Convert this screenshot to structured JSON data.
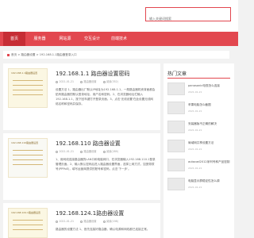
{
  "search": {
    "placeholder": "输入关键词搜索"
  },
  "nav": [
    {
      "label": "首页"
    },
    {
      "label": "服务器"
    },
    {
      "label": "网站源"
    },
    {
      "label": "交互设计"
    },
    {
      "label": "前端技术"
    }
  ],
  "breadcrumb": "首页 > 路由器设置 > 192.168.1.1路由器登录入口",
  "articles": [
    {
      "thumb_title": "192.168.1.1路由器设置",
      "title": "192.168.1.1 路由器设置密码",
      "date": "2021-01-21",
      "category": "路由器设置",
      "views": "阅读(352)",
      "excerpt": "设置方法 1、路由器出厂默认IP地址为192.168.1.1，一般路由器机壳背面都会贴有路由器的默认登录地址、用户名和密码。2、在浏览器地址栏输入192.168.1.1，按下回车键打开登录页面。3、点击'无线设置'在此设置无线网络名称和密码并保存。"
    },
    {
      "thumb_title": "192.168.110路由器设置",
      "title": "192.168.110 路由器设置",
      "date": "2021-01-21",
      "category": "路由器设置",
      "views": "阅读(289)",
      "excerpt": "1、用网线连接路由器的LAN口和电脑网口，在浏览器输入192.168.110.1登录管理页面。2、输入默认密码后进入路由器设置界面，选择上网方式，如宽带拨号(PPPoE)，填写运营商提供的账号和密码，点击'下一步'。"
    },
    {
      "thumb_title": "192.168.124.1路由器设置",
      "title": "192.168.124.1路由器设置",
      "date": "2021-01-21",
      "category": "路由器设置",
      "views": "阅读(198)",
      "excerpt": "路由器的设置方法 1、首先连接好路由器，确认电源和网线都已连接正常。"
    }
  ],
  "sidebar": {
    "title": "热门文章",
    "items": [
      {
        "text": "panasonic电视怎么连接",
        "date": "2021-01-21"
      },
      {
        "text": "苹果电脑怎么截图",
        "date": "2021-01-21"
      },
      {
        "text": "安装器版不正确的解决",
        "date": "2021-01-21"
      },
      {
        "text": "局域网共享设置方法",
        "date": "2021-01-21"
      },
      {
        "text": "autocad2012序列号和产品密钥",
        "date": "2021-01-21"
      },
      {
        "text": "电脑显示屏稳定性怎么调",
        "date": "2021-01-21"
      }
    ]
  }
}
